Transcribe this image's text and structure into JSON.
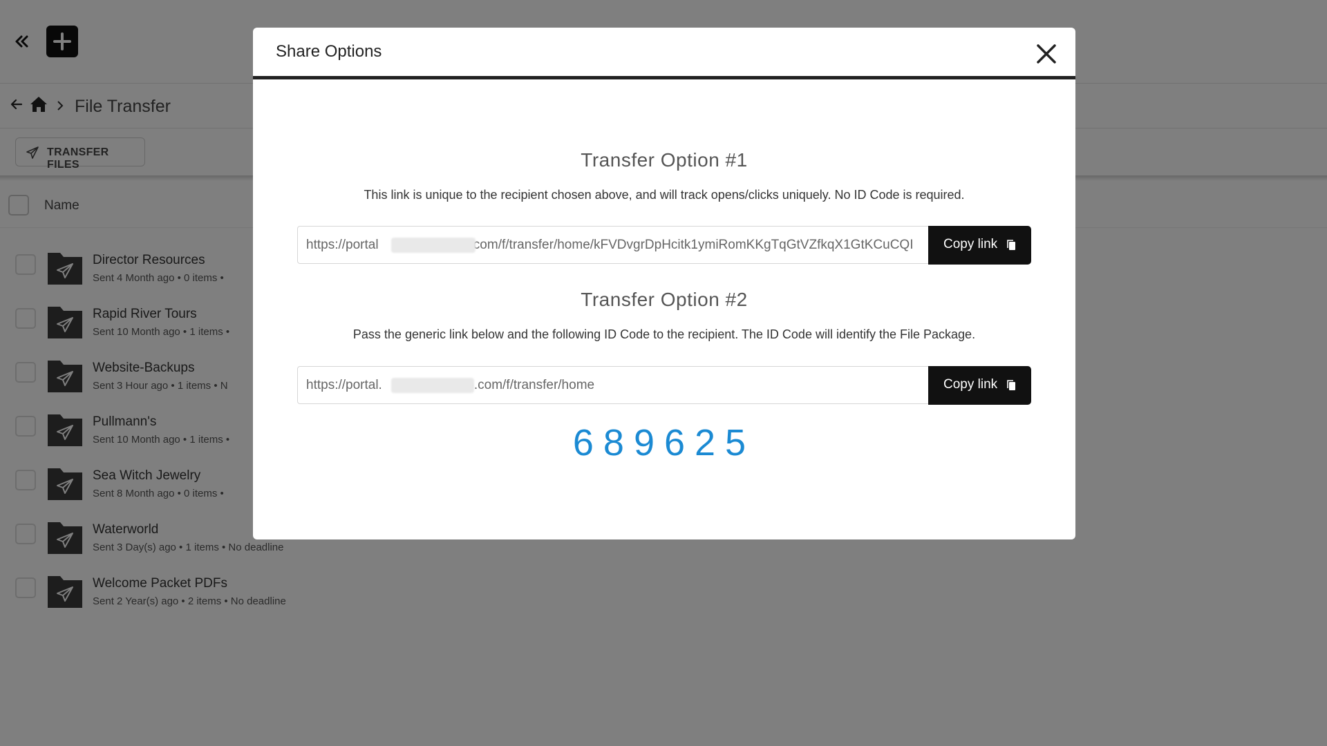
{
  "header": {
    "collapse_icon": "double-chevron-left-icon",
    "add_icon": "plus-icon"
  },
  "breadcrumb": {
    "back_icon": "arrow-left-icon",
    "home_icon": "home-icon",
    "separator_icon": "chevron-right-icon",
    "current": "File Transfer"
  },
  "toolbar": {
    "transfer_label": "TRANSFER FILES",
    "transfer_icon": "paper-plane-icon"
  },
  "list": {
    "header_name": "Name",
    "rows": [
      {
        "title": "Director Resources",
        "meta": "Sent 4 Month ago  •  0 items  •"
      },
      {
        "title": "Rapid River Tours",
        "meta": "Sent 10 Month ago  •  1 items  •"
      },
      {
        "title": "Website-Backups",
        "meta": "Sent 3 Hour ago  •  1 items  •  N"
      },
      {
        "title": "Pullmann's",
        "meta": "Sent 10 Month ago  •  1 items  •"
      },
      {
        "title": "Sea Witch Jewelry",
        "meta": "Sent 8 Month ago  •  0 items  •"
      },
      {
        "title": "Waterworld",
        "meta": "Sent 3 Day(s) ago  •  1 items  •  No deadline"
      },
      {
        "title": "Welcome Packet PDFs",
        "meta": "Sent 2 Year(s) ago  •  2 items  •  No deadline"
      }
    ]
  },
  "modal": {
    "title": "Share Options",
    "close_icon": "close-icon",
    "option1": {
      "heading": "Transfer Option #1",
      "description": "This link is unique to the recipient chosen above, and will track opens/clicks uniquely. No ID Code is required.",
      "link": "https://portal                         .com/f/transfer/home/kFVDvgrDpHcitk1ymiRomKKgTqGtVZfkqX1GtKCuCQI",
      "copy_label": "Copy link",
      "copy_icon": "copy-icon"
    },
    "option2": {
      "heading": "Transfer Option #2",
      "description": "Pass the generic link below and the following ID Code to the recipient. The ID Code will identify the File Package.",
      "link": "https://portal.                        ).com/f/transfer/home",
      "copy_label": "Copy link",
      "copy_icon": "copy-icon",
      "id_code": "689625"
    }
  },
  "colors": {
    "overlay": "#000000",
    "accent_blue": "#1b8ad3",
    "button_dark": "#111111"
  }
}
